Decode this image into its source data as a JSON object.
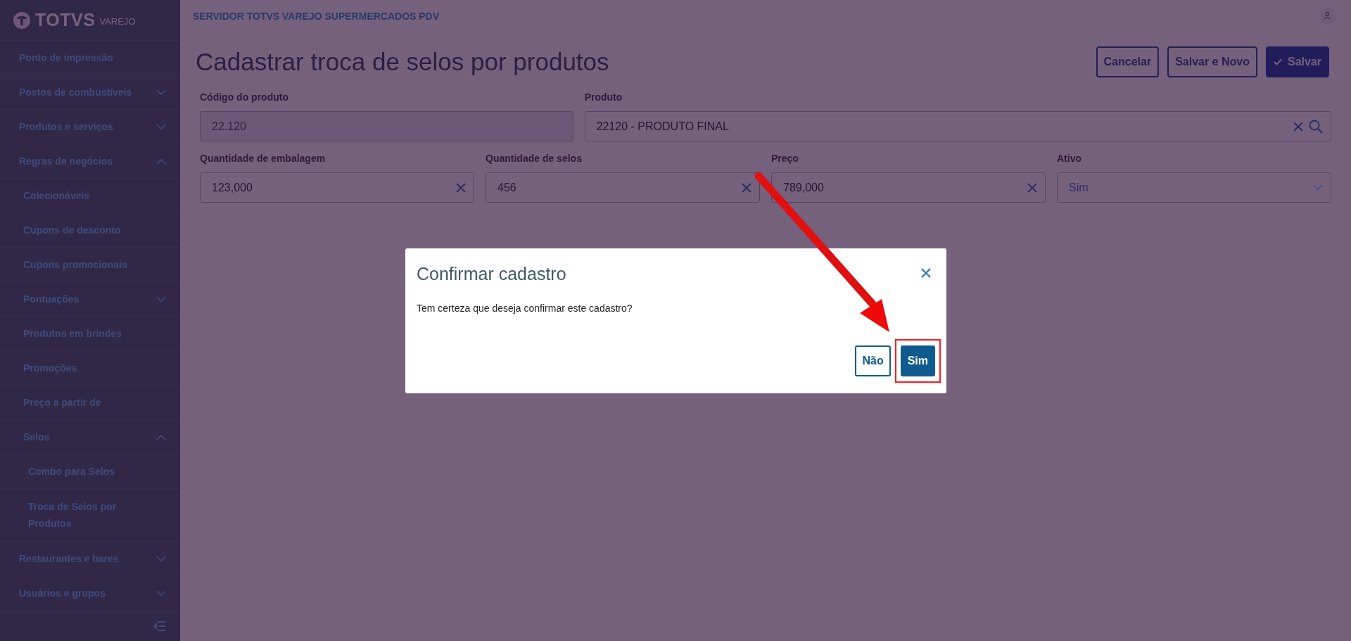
{
  "sidebar": {
    "logo": {
      "brand": "TOTVS",
      "product": "VAREJO"
    },
    "items": [
      {
        "label": "Ponto de impressão"
      },
      {
        "label": "Postos de combustíveis",
        "expanded": false
      },
      {
        "label": "Produtos e serviços",
        "expanded": false
      },
      {
        "label": "Regras de negócios",
        "expanded": true,
        "children": [
          {
            "label": "Colecionáveis"
          },
          {
            "label": "Cupons de desconto"
          },
          {
            "label": "Cupons promocionais"
          },
          {
            "label": "Pontuações",
            "expanded": false
          },
          {
            "label": "Produtos em brindes"
          },
          {
            "label": "Promoções"
          },
          {
            "label": "Preço a partir de"
          },
          {
            "label": "Selos",
            "expanded": true,
            "children": [
              {
                "label": "Combo para Selos"
              },
              {
                "label": "Troca de Selos por Produtos"
              }
            ]
          }
        ]
      },
      {
        "label": "Restaurantes e bares",
        "expanded": false
      },
      {
        "label": "Usuários e grupos",
        "expanded": false
      }
    ]
  },
  "header": {
    "server": "SERVIDOR TOTVS VAREJO SUPERMERCADOS PDV"
  },
  "page": {
    "title": "Cadastrar troca de selos por produtos",
    "actions": [
      {
        "label": "Cancelar",
        "kind": "secondary"
      },
      {
        "label": "Salvar e Novo",
        "kind": "secondary"
      },
      {
        "label": "Salvar",
        "kind": "primary"
      }
    ]
  },
  "form": {
    "rows": [
      [
        {
          "label": "Código do produto",
          "value": "22.120",
          "kind": "text",
          "disabled": true,
          "clearable": false
        },
        {
          "label": "Produto",
          "value": "22120 - PRODUTO FINAL",
          "kind": "lookup",
          "disabled": false,
          "clearable": true
        }
      ]
    ],
    "rows2": [
      {
        "label": "Quantidade de embalagem",
        "value": "123,000",
        "kind": "text",
        "disabled": false,
        "clearable": true
      },
      {
        "label": "Quantidade de selos",
        "value": "456",
        "kind": "text",
        "disabled": false,
        "clearable": true
      },
      {
        "label": "Preço",
        "value": "789,000",
        "kind": "text",
        "disabled": false,
        "clearable": true
      },
      {
        "label": "Ativo",
        "value": "Sim",
        "kind": "select",
        "disabled": false,
        "clearable": false
      }
    ]
  },
  "dialog": {
    "title": "Confirmar cadastro",
    "message": "Tem certeza que deseja confirmar este cadastro?",
    "buttons": [
      {
        "label": "Não",
        "kind": "secondary",
        "highlighted": false
      },
      {
        "label": "Sim",
        "kind": "primary",
        "highlighted": true
      }
    ]
  }
}
